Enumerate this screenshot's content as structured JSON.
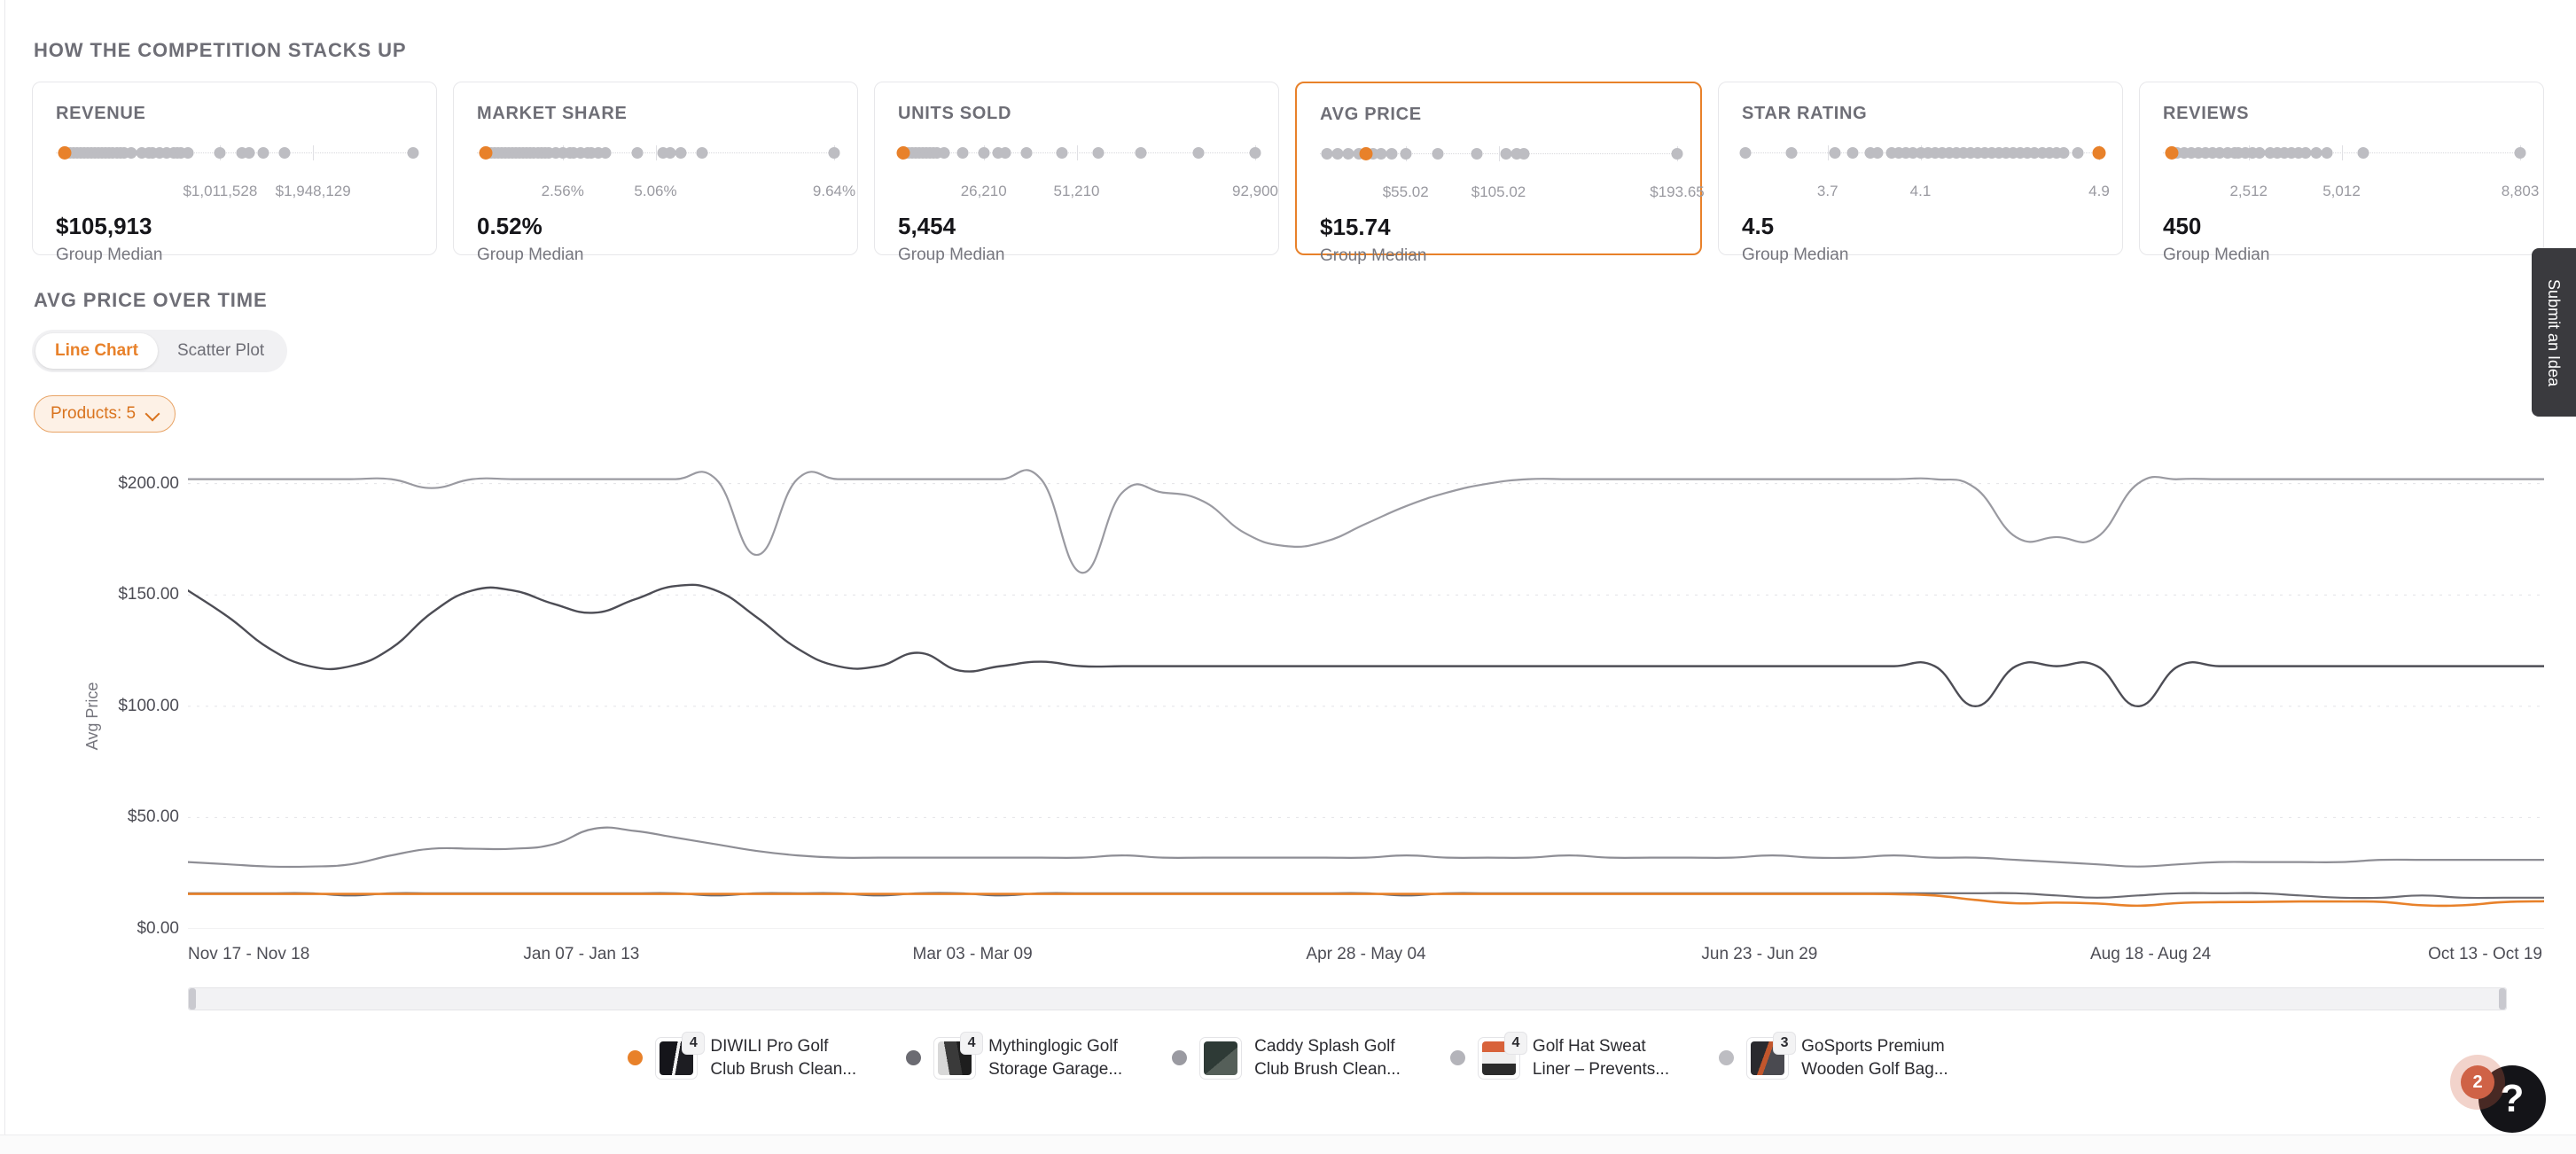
{
  "section": {
    "title": "How the Competition Stacks Up"
  },
  "colors": {
    "accent": "#e8812a",
    "dot_inactive": "#bdbdc2",
    "text_muted": "#6e6e76",
    "badge": "#cf6246"
  },
  "cards": [
    {
      "title": "REVENUE",
      "value": "$105,913",
      "sub": "Group Median",
      "ticks": [
        "$1,011,528",
        "$1,948,129"
      ],
      "tick_pos": [
        46,
        72
      ],
      "highlight_pos": 2.5,
      "dots": [
        2.5,
        4,
        5,
        6,
        7,
        8,
        9,
        10,
        11,
        12,
        13,
        14,
        15,
        16,
        17,
        18,
        19,
        21,
        24,
        26,
        27,
        29,
        31,
        33,
        34,
        35,
        37,
        46,
        52,
        54,
        58,
        64,
        100
      ]
    },
    {
      "title": "MARKET SHARE",
      "value": "0.52%",
      "sub": "Group Median",
      "ticks": [
        "2.56%",
        "9.64%"
      ],
      "tick_pos": [
        24,
        100
      ],
      "extra_tick": {
        "label": "5.06%",
        "pos": 50
      },
      "highlight_pos": 2.5,
      "dots": [
        2.5,
        4,
        5,
        6,
        7,
        8,
        9,
        10,
        11,
        12,
        13,
        14,
        15,
        16,
        17,
        18,
        19,
        20,
        22,
        24,
        26,
        27,
        29,
        31,
        32,
        34,
        36,
        45,
        52,
        54,
        57,
        63,
        100
      ]
    },
    {
      "title": "UNITS SOLD",
      "value": "5,454",
      "sub": "Group Median",
      "ticks": [
        "26,210",
        "51,210",
        "92,900"
      ],
      "tick_pos": [
        24,
        50,
        100
      ],
      "highlight_pos": 1.5,
      "dots": [
        1.5,
        3,
        4,
        5,
        6,
        7,
        8,
        9,
        10,
        11,
        13,
        18,
        24,
        28,
        30,
        36,
        46,
        56,
        68,
        84,
        100
      ]
    },
    {
      "title": "AVG PRICE",
      "value": "$15.74",
      "sub": "Group Median",
      "selected": true,
      "ticks": [
        "$55.02",
        "$105.02",
        "$193.65"
      ],
      "tick_pos": [
        24,
        50,
        100
      ],
      "highlight_pos": 13,
      "dots": [
        2,
        5,
        8,
        11,
        13,
        15,
        17,
        20,
        24,
        33,
        44,
        52,
        55,
        57,
        100
      ]
    },
    {
      "title": "STAR RATING",
      "value": "4.5",
      "sub": "Group Median",
      "ticks": [
        "3.7",
        "4.1",
        "4.9"
      ],
      "tick_pos": [
        24,
        50,
        100
      ],
      "highlight_pos": 100,
      "dots": [
        1,
        14,
        26,
        31,
        36,
        38,
        42,
        44,
        46,
        48,
        50,
        52,
        54,
        56,
        58,
        60,
        62,
        64,
        66,
        68,
        70,
        72,
        74,
        76,
        78,
        80,
        82,
        84,
        86,
        88,
        90,
        94,
        100
      ]
    },
    {
      "title": "REVIEWS",
      "value": "450",
      "sub": "Group Median",
      "ticks": [
        "2,512",
        "5,012",
        "8,803"
      ],
      "tick_pos": [
        24,
        50,
        100
      ],
      "highlight_pos": 2.5,
      "dots": [
        2.5,
        4,
        6,
        8,
        10,
        12,
        14,
        16,
        18,
        20,
        21,
        23,
        25,
        27,
        30,
        32,
        34,
        36,
        38,
        40,
        43,
        46,
        56,
        100
      ]
    }
  ],
  "chart": {
    "title": "Avg Price Over Time",
    "view_options": [
      {
        "label": "Line Chart",
        "active": true
      },
      {
        "label": "Scatter Plot",
        "active": false
      }
    ],
    "filter_pill": "Products: 5"
  },
  "legend": [
    {
      "color": "#e8812a",
      "badge": "4",
      "line1": "DIWILI Pro Golf",
      "line2": "Club Brush Clean..."
    },
    {
      "color": "#6b6b72",
      "badge": "4",
      "line1": "Mythinglogic Golf",
      "line2": "Storage Garage..."
    },
    {
      "color": "#9a9aa1",
      "badge": "",
      "line1": "Caddy Splash Golf",
      "line2": "Club Brush Clean..."
    },
    {
      "color": "#b4b4ba",
      "badge": "4",
      "line1": "Golf Hat Sweat",
      "line2": "Liner – Prevents..."
    },
    {
      "color": "#bdbdc2",
      "badge": "3",
      "line1": "GoSports Premium",
      "line2": "Wooden Golf Bag..."
    }
  ],
  "side_tab": {
    "label": "Submit an Idea"
  },
  "help": {
    "glyph": "?",
    "badge_count": "2"
  },
  "chart_data": {
    "type": "line",
    "title": "Avg Price Over Time",
    "xlabel": "",
    "ylabel": "Avg Price",
    "ylim": [
      0,
      215
    ],
    "ytick_labels": [
      "$200.00",
      "$150.00",
      "$100.00",
      "$50.00",
      "$0.00"
    ],
    "ytick_values": [
      200,
      150,
      100,
      50,
      0
    ],
    "xtick_labels": [
      "Nov 17 - Nov 18",
      "Jan 07 - Jan 13",
      "Mar 03 - Mar 09",
      "Apr 28 - May 04",
      "Jun 23 - Jun 29",
      "Aug 18 - Aug 24",
      "Oct 13 - Oct 19"
    ],
    "xtick_pos": [
      0.0,
      0.167,
      0.333,
      0.5,
      0.667,
      0.833,
      0.975
    ],
    "grid": "horizontal-dotted",
    "legend_position": "bottom",
    "series": [
      {
        "name": "Caddy Splash Golf Club Brush Clean...",
        "color": "#9a9aa1",
        "width": 2.2,
        "values": [
          202,
          202,
          202,
          202,
          202,
          202,
          198,
          202,
          202,
          202,
          202,
          202,
          202,
          202,
          168,
          202,
          202,
          202,
          202,
          202,
          202,
          202,
          160,
          196,
          196,
          192,
          178,
          172,
          174,
          182,
          190,
          196,
          200,
          202,
          202,
          202,
          202,
          202,
          202,
          202,
          202,
          202,
          202,
          202,
          198,
          176,
          176,
          176,
          200,
          202,
          202,
          202,
          202,
          202,
          202,
          202,
          202,
          202,
          202
        ]
      },
      {
        "name": "Mythinglogic Golf Storage Garage...",
        "color": "#4d4d55",
        "width": 2.4,
        "values": [
          152,
          140,
          126,
          118,
          118,
          126,
          142,
          152,
          152,
          146,
          142,
          148,
          154,
          152,
          140,
          126,
          118,
          118,
          124,
          116,
          118,
          120,
          118,
          118,
          118,
          118,
          118,
          118,
          118,
          118,
          118,
          118,
          118,
          118,
          118,
          118,
          118,
          118,
          118,
          118,
          118,
          118,
          118,
          118,
          100,
          118,
          118,
          118,
          100,
          118,
          118,
          118,
          118,
          118,
          118,
          118,
          118,
          118,
          118
        ]
      },
      {
        "name": "Golf Hat Sweat Liner – Prevents...",
        "color": "#8e8e95",
        "width": 2.2,
        "values": [
          30,
          29,
          28,
          28,
          29,
          33,
          36,
          36,
          36,
          38,
          45,
          44,
          41,
          38,
          35,
          33,
          32,
          32,
          32,
          32,
          32,
          32,
          32,
          33,
          32,
          32,
          32,
          32,
          32,
          32,
          33,
          32,
          32,
          32,
          33,
          32,
          32,
          32,
          32,
          33,
          32,
          32,
          33,
          32,
          32,
          31,
          30,
          29,
          28,
          29,
          30,
          30,
          30,
          30,
          31,
          31,
          31,
          31,
          31
        ]
      },
      {
        "name": "GoSports Premium Wooden Golf Bag...",
        "color": "#6b6b72",
        "width": 2.2,
        "values": [
          16,
          16,
          16,
          16,
          15,
          16,
          16,
          16,
          16,
          16,
          16,
          16,
          16,
          15,
          16,
          16,
          16,
          15,
          16,
          16,
          15,
          16,
          16,
          16,
          16,
          16,
          16,
          16,
          16,
          16,
          15,
          16,
          16,
          16,
          16,
          16,
          16,
          16,
          16,
          16,
          16,
          16,
          16,
          16,
          16,
          16,
          15,
          14,
          15,
          16,
          16,
          16,
          15,
          14,
          14,
          15,
          14,
          14,
          14
        ]
      },
      {
        "name": "DIWILI Pro Golf Club Brush Clean...",
        "color": "#e8812a",
        "width": 2.6,
        "values": [
          15.7,
          15.7,
          15.7,
          15.7,
          15.7,
          15.7,
          15.7,
          15.7,
          15.7,
          15.7,
          15.7,
          15.7,
          15.7,
          15.7,
          15.7,
          15.7,
          15.7,
          15.7,
          15.7,
          15.7,
          15.7,
          15.7,
          15.7,
          15.7,
          15.7,
          15.7,
          15.7,
          15.7,
          15.7,
          15.7,
          15.7,
          15.7,
          15.7,
          15.7,
          15.7,
          15.7,
          15.7,
          15.7,
          15.7,
          15.7,
          15.7,
          15.7,
          15.6,
          15.0,
          13.0,
          11.5,
          11.8,
          11.4,
          10.4,
          11.6,
          12.0,
          12.1,
          12.3,
          12.3,
          12.1,
          10.6,
          10.6,
          12.0,
          12.4
        ]
      }
    ]
  }
}
